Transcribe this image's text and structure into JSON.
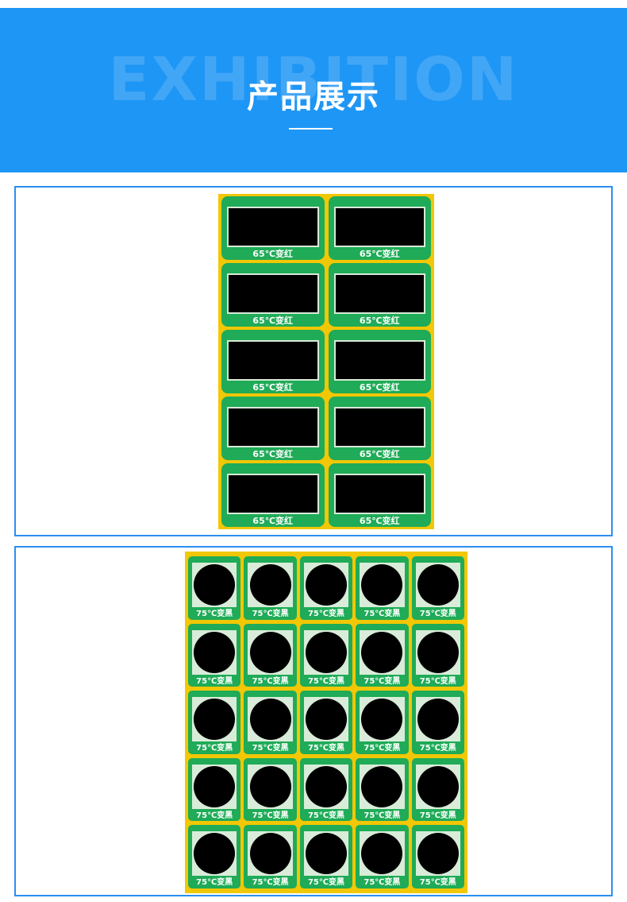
{
  "header": {
    "watermark": "EXHIBITION",
    "title": "产品展示",
    "background_color": "#1e96f5"
  },
  "product1": {
    "label_text": "65℃变红",
    "rows": 5,
    "cols": 2,
    "label_color": "#1fab57",
    "sheet_color": "#f2c705",
    "indicator_color": "#000000"
  },
  "product2": {
    "label_text": "75℃变黑",
    "rows": 5,
    "cols": 5,
    "label_color": "#1fab57",
    "sheet_color": "#f2c705",
    "indicator_color": "#000000"
  }
}
